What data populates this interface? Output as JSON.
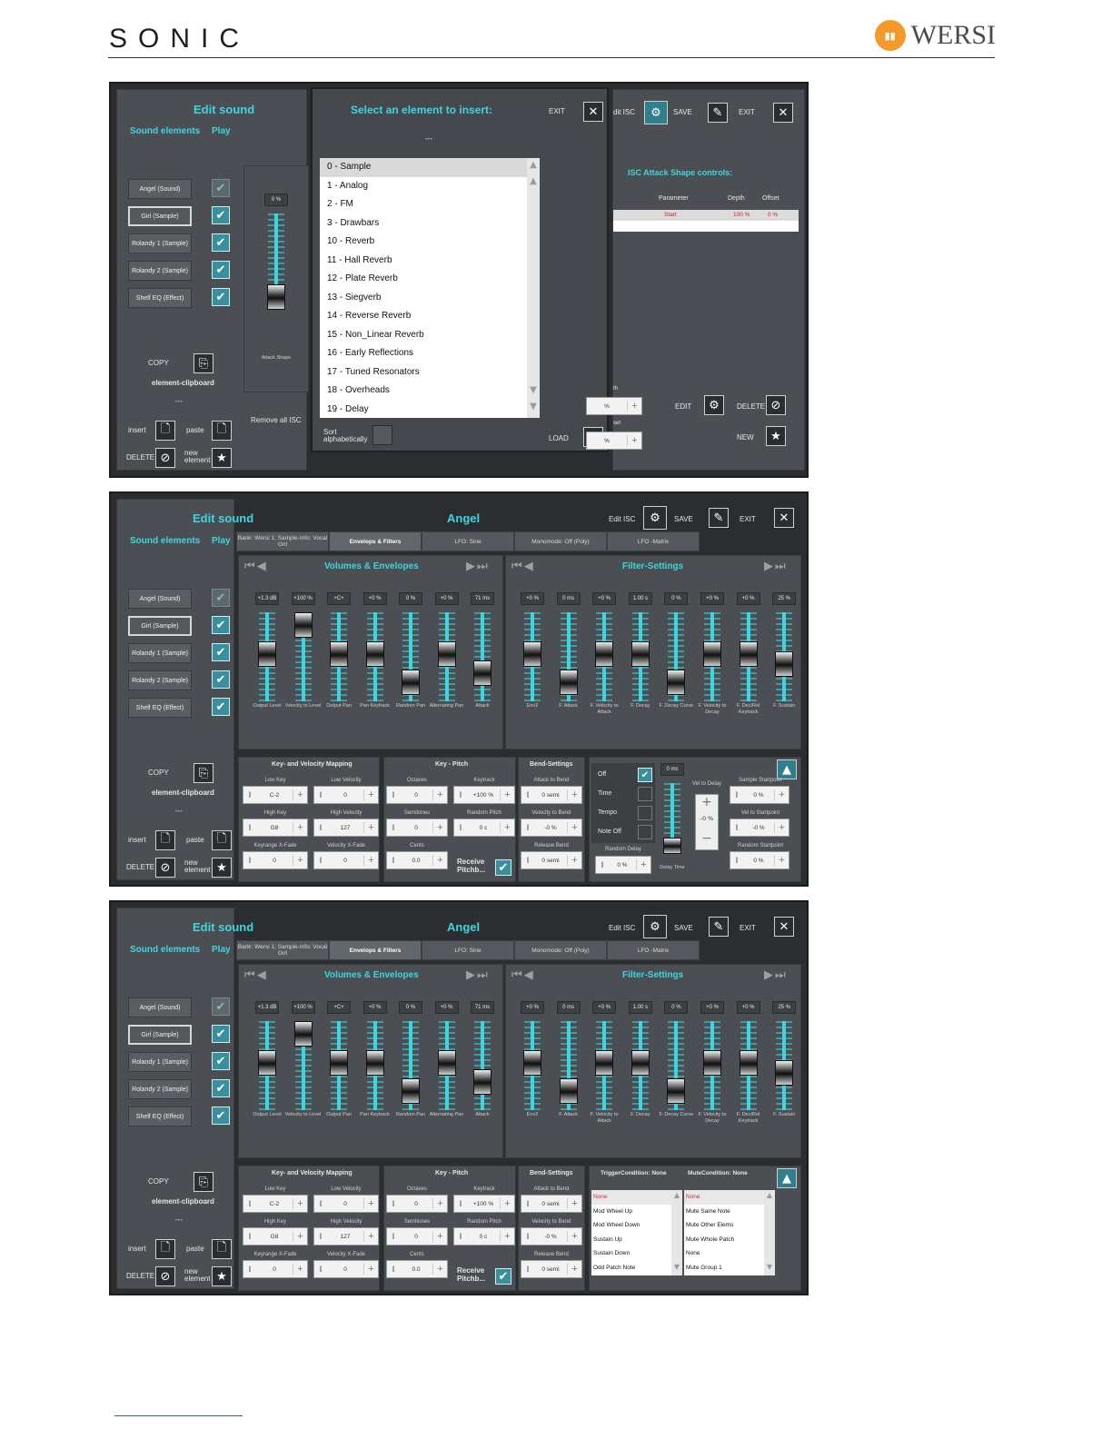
{
  "page": {
    "brand_left": "SONIC",
    "brand_right": "WERSI"
  },
  "common": {
    "edit_sound": "Edit sound",
    "sound_elements": "Sound elements",
    "play": "Play",
    "elements": [
      "Angel (Sound)",
      "Girl (Sample)",
      "Rolandy 1 (Sample)",
      "Rolandy 2 (Sample)",
      "Shelf EQ (Effect)"
    ],
    "copy": "COPY",
    "element_clipboard": "element-clipboard",
    "clipboard_value": "---",
    "insert": "insert",
    "paste": "paste",
    "delete": "DELETE",
    "new_element": "new element",
    "edit_isc": "Edit ISC",
    "save": "SAVE",
    "exit": "EXIT",
    "sound_name": "Angel"
  },
  "shot1": {
    "dialog_title": "Select an element to insert:",
    "dialog_exit": "EXIT",
    "dialog_subtitle": "---",
    "options": [
      "0 - Sample",
      "1 - Analog",
      "2 - FM",
      "3 - Drawbars",
      "10 - Reverb",
      "11 - Hall Reverb",
      "12 - Plate Reverb",
      "13 - Siegverb",
      "14 - Reverse Reverb",
      "15 - Non_Linear Reverb",
      "16 - Early Reflections",
      "17 - Tuned Resonators",
      "18 - Overheads",
      "19 - Delay"
    ],
    "sort": "Sort alphabetically",
    "load": "LOAD",
    "slider_value": "0 %",
    "slider_label": "Attack Shape",
    "remove_all_isc": "Remove all ISC",
    "isc_header": "dit ISC",
    "isc_title": "ISC Attack Shape controls:",
    "cols": [
      "Parameter",
      "Depth",
      "Offset"
    ],
    "row": [
      "Start",
      "100 %",
      "0 %"
    ],
    "edit": "EDIT",
    "delete": "DELETE",
    "new": "NEW",
    "frag1": "th",
    "frag2": "set"
  },
  "editor": {
    "tabs": [
      "Bank: Wersi 1; Sample-Info: Vocal Girl",
      "Envelops & Filters",
      "LFO: Sine",
      "Monomode: Off (Poly)",
      "LFO -Matrix"
    ],
    "volumes_title": "Volumes & Envelopes",
    "filter_title": "Filter-Settings",
    "volume_sliders": [
      {
        "v": "+1.3 dB",
        "c": "Output Level",
        "pos": 0.45
      },
      {
        "v": "+100 %",
        "c": "Velocity to Level",
        "pos": 0.0
      },
      {
        "v": "+C+",
        "c": "Output Pan",
        "pos": 0.45
      },
      {
        "v": "+0 %",
        "c": "Pan Keytrack",
        "pos": 0.45
      },
      {
        "v": "0 %",
        "c": "Random Pan",
        "pos": 0.9
      },
      {
        "v": "+0 %",
        "c": "Alternating Pan",
        "pos": 0.45
      },
      {
        "v": "71 ms",
        "c": "Attack",
        "pos": 0.75
      }
    ],
    "filter_sliders": [
      {
        "v": "+0 %",
        "c": "Env2",
        "pos": 0.45
      },
      {
        "v": "0 ms",
        "c": "F. Attack",
        "pos": 0.9
      },
      {
        "v": "+0 %",
        "c": "F. Velocity to Attack",
        "pos": 0.45
      },
      {
        "v": "1.00 s",
        "c": "F. Decay",
        "pos": 0.45
      },
      {
        "v": "0 %",
        "c": "F. Decay Curve",
        "pos": 0.9
      },
      {
        "v": "+0 %",
        "c": "F. Velocity to Decay",
        "pos": 0.45
      },
      {
        "v": "+0 %",
        "c": "F. Dec/Rel Keytrack",
        "pos": 0.45
      },
      {
        "v": "25 %",
        "c": "F. Sustain",
        "pos": 0.62
      }
    ],
    "kv_title": "Key- and Velocity Mapping",
    "kp_title": "Key - Pitch",
    "bend_title": "Bend-Settings",
    "kv": [
      {
        "l": "Low Key",
        "v": "C-2"
      },
      {
        "l": "Low Velocity",
        "v": "0"
      },
      {
        "l": "High Key",
        "v": "G8"
      },
      {
        "l": "High Velocity",
        "v": "127"
      },
      {
        "l": "Keyrange X-Fade",
        "v": "0"
      },
      {
        "l": "Velocity X-Fade",
        "v": "0"
      }
    ],
    "kp": [
      {
        "l": "Octaves",
        "v": "0"
      },
      {
        "l": "Keytrack",
        "v": "+100 %"
      },
      {
        "l": "Semitones",
        "v": "0"
      },
      {
        "l": "Random Pitch",
        "v": "0 c"
      },
      {
        "l": "Cents",
        "v": "0.0"
      }
    ],
    "receive_pitch": "Receive Pitchb...",
    "bend": [
      {
        "l": "Attack to Bend",
        "v": "0 semi"
      },
      {
        "l": "Velocity to Bend",
        "v": "-0 %"
      },
      {
        "l": "Release Bend",
        "v": "0 semi"
      }
    ]
  },
  "shot2": {
    "trigger_options": [
      "Off",
      "Time",
      "Tempo",
      "Note Off"
    ],
    "delay_value": "0 ms",
    "delay_label": "Delay Time",
    "random_delay": "Random Delay",
    "random_delay_value": "0 %",
    "vel_to_delay": "Vel to Delay",
    "vel_to_delay_value": "-0 %",
    "sample_startpoint": "Sample Startpoint",
    "sample_startpoint_value": "0 %",
    "vel_to_startpoint": "Vel to Startpoint",
    "vel_to_startpoint_value": "-0 %",
    "random_startpoint": "Random Startpoint",
    "random_startpoint_value": "0 %"
  },
  "shot3": {
    "trigger_condition": "TriggerCondition: None",
    "mute_condition": "MuteCondition: None",
    "trigger_list": [
      "None",
      "Mod Wheel Up",
      "Mod Wheel Down",
      "Sustain Up",
      "Sustain Down",
      "Odd Patch Note"
    ],
    "mute_list": [
      "None",
      "Mute Same Note",
      "Mute Other Elems",
      "Mute Whole Patch",
      "None",
      "Mute Group 1"
    ]
  }
}
